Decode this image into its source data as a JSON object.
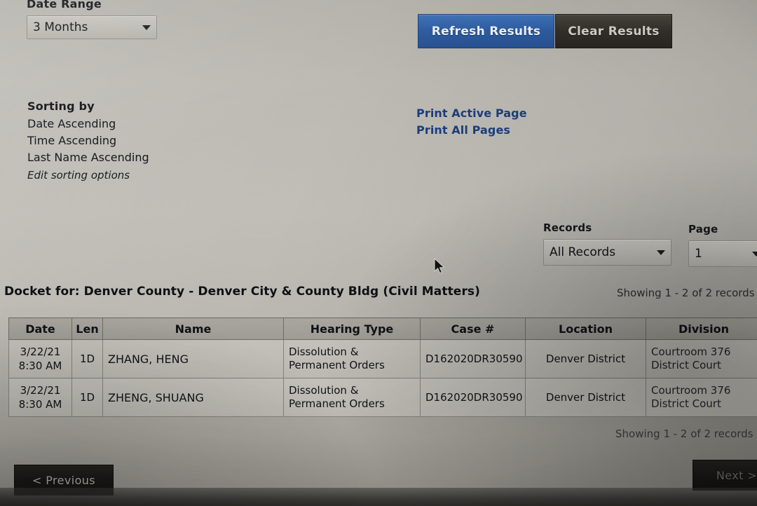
{
  "filters": {
    "date_range_label": "Date Range",
    "date_range_value": "3 Months"
  },
  "actions": {
    "refresh_label": "Refresh Results",
    "clear_label": "Clear Results"
  },
  "sorting": {
    "title": "Sorting by",
    "criteria": [
      "Date Ascending",
      "Time Ascending",
      "Last Name Ascending"
    ],
    "edit_link": "Edit sorting options"
  },
  "print": {
    "active_page": "Print Active Page",
    "all_pages": "Print All Pages"
  },
  "records": {
    "label": "Records",
    "value": "All Records"
  },
  "page": {
    "label": "Page",
    "value": "1"
  },
  "docket": {
    "title": "Docket for: Denver County - Denver City & County Bldg (Civil Matters)",
    "showing_top": "Showing 1 - 2 of 2 records",
    "showing_bottom": "Showing 1 - 2 of 2 records",
    "columns": [
      "Date",
      "Len",
      "Name",
      "Hearing Type",
      "Case #",
      "Location",
      "Division"
    ],
    "rows": [
      {
        "date": "3/22/21",
        "time": "8:30 AM",
        "len": "1D",
        "name": "ZHANG, HENG",
        "hearing_type_line1": "Dissolution &",
        "hearing_type_line2": "Permanent Orders",
        "case": "D162020DR30590",
        "location": "Denver District",
        "division_line1": "Courtroom 376",
        "division_line2": "District Court"
      },
      {
        "date": "3/22/21",
        "time": "8:30 AM",
        "len": "1D",
        "name": "ZHENG, SHUANG",
        "hearing_type_line1": "Dissolution &",
        "hearing_type_line2": "Permanent Orders",
        "case": "D162020DR30590",
        "location": "Denver District",
        "division_line1": "Courtroom 376",
        "division_line2": "District Court"
      }
    ]
  },
  "pagination": {
    "previous_label": "< Previous",
    "next_label": "Next >"
  },
  "colors": {
    "primary_button": "#2d5a9e",
    "secondary_button": "#312e29",
    "link": "#1c3d7a",
    "page_background": "#bcbab3"
  },
  "icons": {
    "dropdown": "chevron-down-icon",
    "pointer": "mouse-pointer-icon"
  }
}
